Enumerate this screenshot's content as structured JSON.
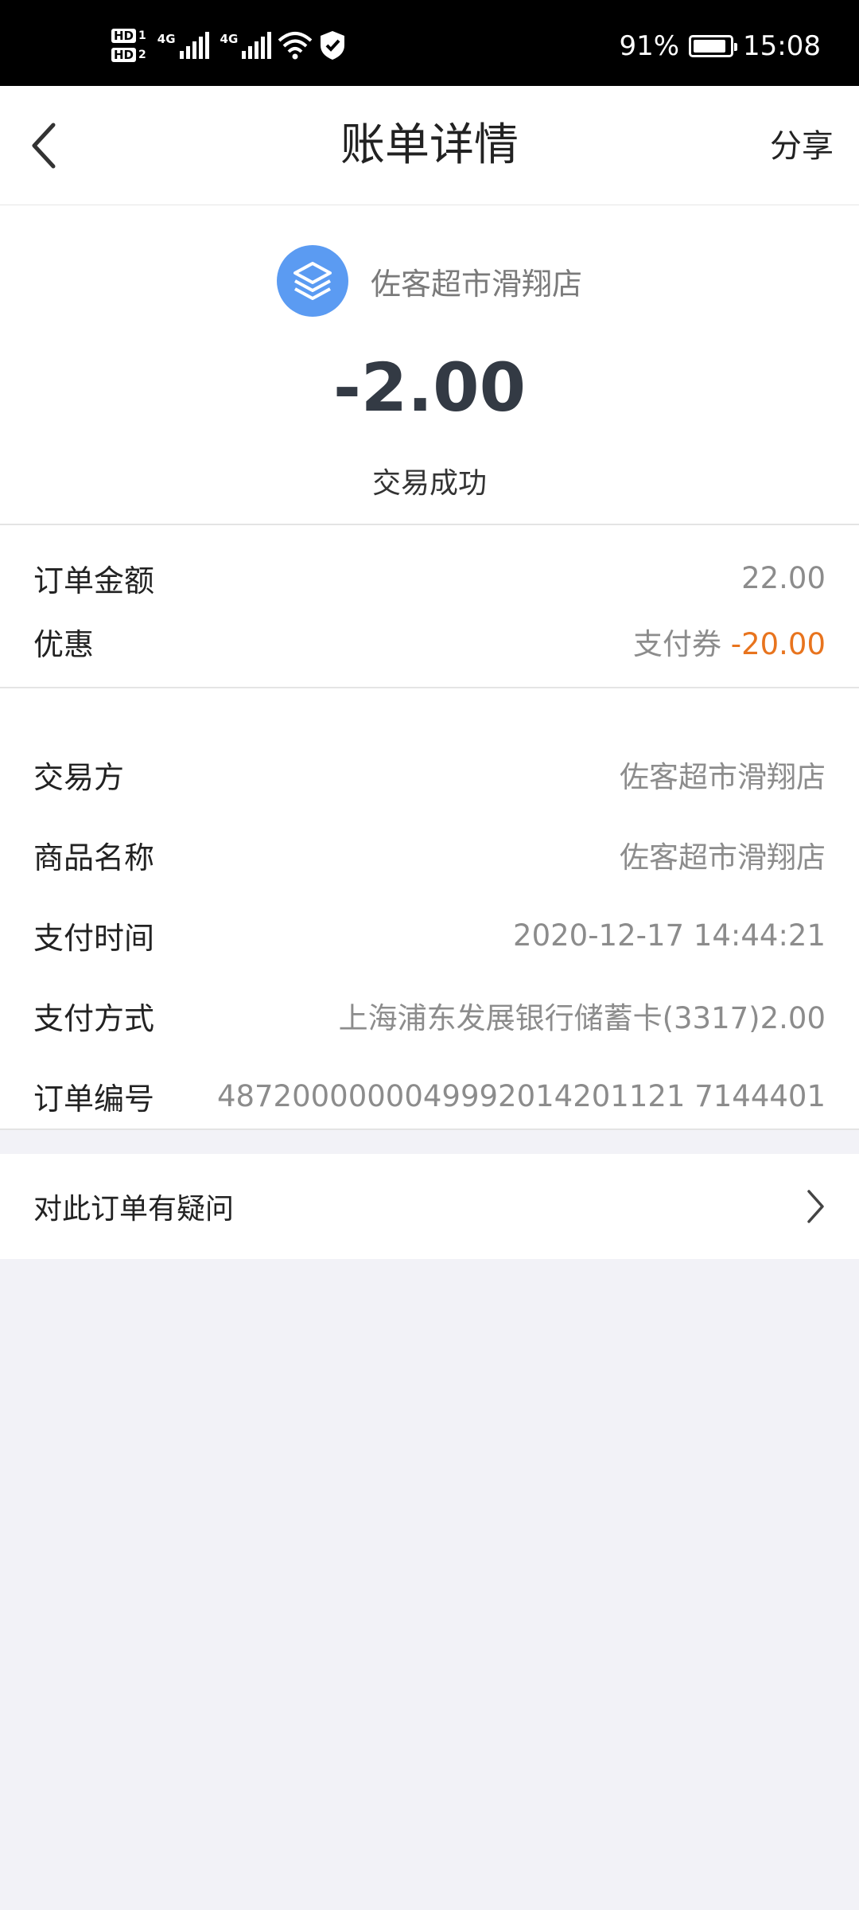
{
  "status_bar": {
    "hd1": "HD",
    "hd1_num": "1",
    "hd2": "HD",
    "hd2_num": "2",
    "net1": "4G",
    "net2": "4G",
    "battery_percent": "91%",
    "battery_level": 0.91,
    "time": "15:08"
  },
  "nav": {
    "title": "账单详情",
    "share_label": "分享"
  },
  "summary": {
    "merchant_name": "佐客超市滑翔店",
    "amount": "-2.00",
    "status": "交易成功"
  },
  "pricing": [
    {
      "key": "订单金额",
      "value": "22.00"
    },
    {
      "key": "优惠",
      "value_prefix": "支付券 ",
      "value_highlight": "-20.00"
    }
  ],
  "details": [
    {
      "key": "交易方",
      "value": "佐客超市滑翔店"
    },
    {
      "key": "商品名称",
      "value": "佐客超市滑翔店"
    },
    {
      "key": "支付时间",
      "value": "2020-12-17 14:44:21"
    },
    {
      "key": "支付方式",
      "value": "上海浦东发展银行储蓄卡(3317)2.00"
    },
    {
      "key": "订单编号",
      "value": "4872000000049992014201121 7144401"
    }
  ],
  "question": {
    "label": "对此订单有疑问"
  },
  "colors": {
    "accent_blue": "#5b9bf2",
    "discount_orange": "#e8741e",
    "background": "#f2f2f7"
  }
}
